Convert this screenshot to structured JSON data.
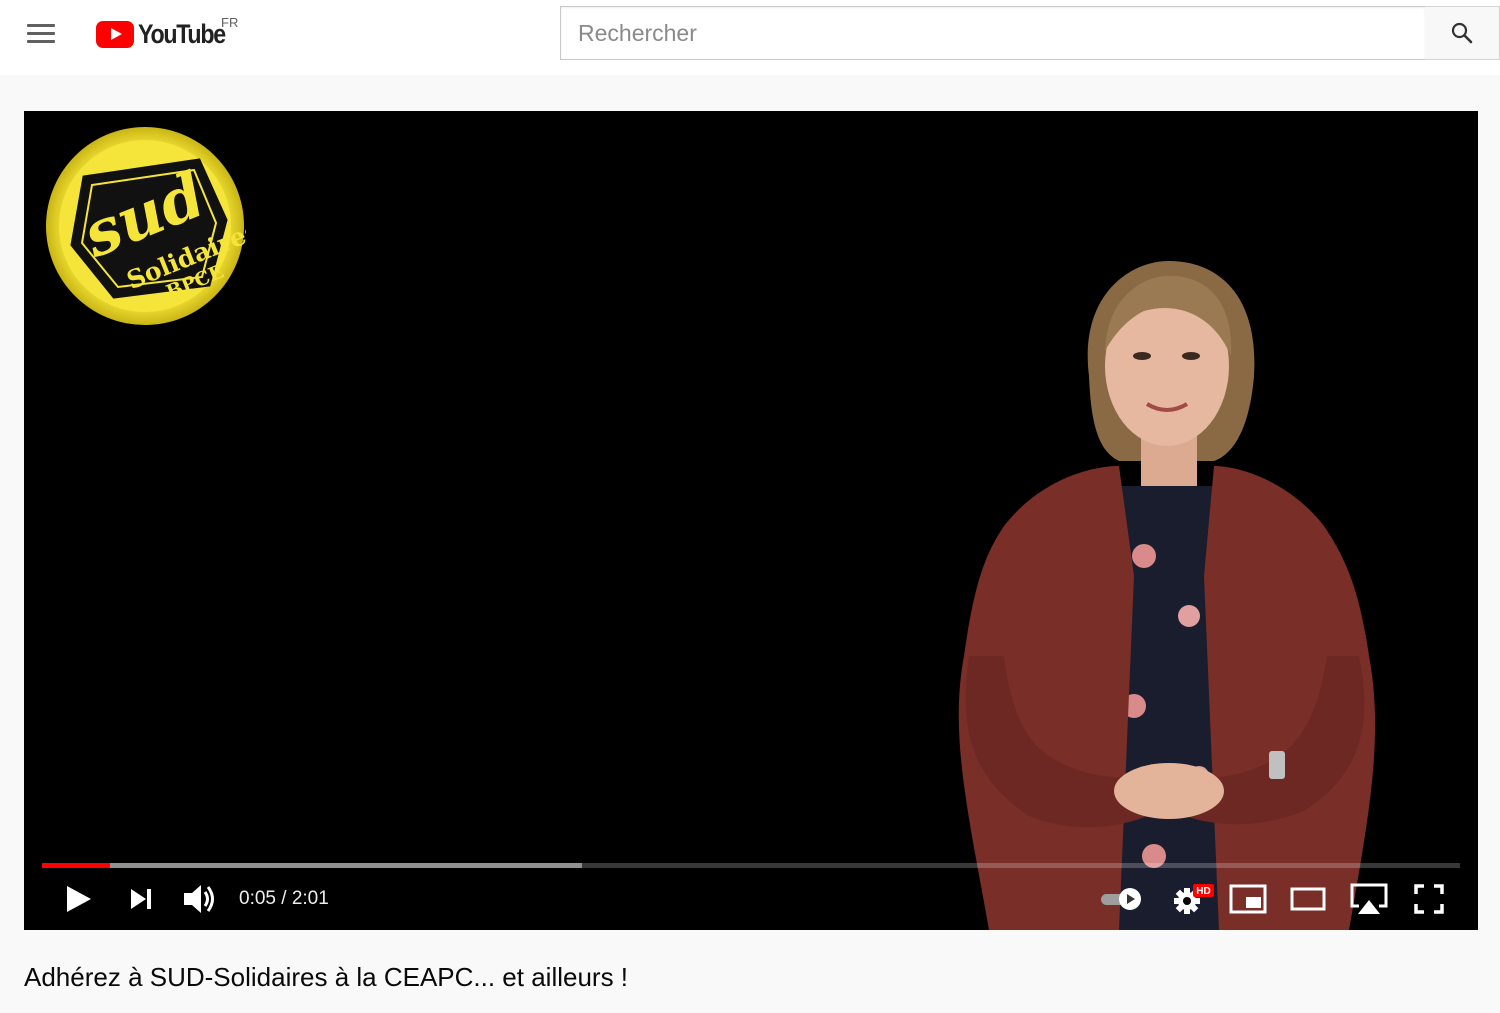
{
  "header": {
    "logo_text": "YouTube",
    "country_code": "FR",
    "search_placeholder": "Rechercher"
  },
  "player": {
    "channel_badge": {
      "text_line1": "sud",
      "text_line2": "Solidaires",
      "text_line3": "BPCE",
      "color": "#f5e53a"
    },
    "time_display": "0:05 / 2:01",
    "current_time": "0:05",
    "duration": "2:01",
    "progress_played_fraction": 0.048,
    "progress_buffered_fraction": 0.381,
    "progress_color": "#ff0000",
    "hd_badge": "HD",
    "controls": [
      "play-icon",
      "next-icon",
      "volume-icon",
      "autoplay-toggle",
      "settings-icon",
      "miniplayer-icon",
      "theater-mode-icon",
      "airplay-icon",
      "fullscreen-icon"
    ]
  },
  "video": {
    "title": "Adhérez à SUD-Solidaires à la CEAPC... et ailleurs !"
  }
}
